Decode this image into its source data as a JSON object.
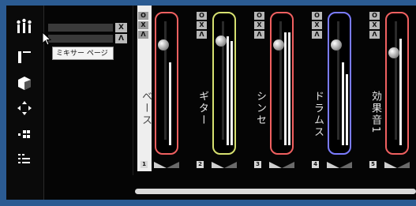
{
  "toolbar": {
    "items": [
      {
        "icon": "mixer-icon",
        "active": true
      },
      {
        "icon": "inspector-panel-icon"
      },
      {
        "icon": "cube-icon"
      },
      {
        "icon": "move-arrows-icon"
      },
      {
        "icon": "grid-dots-icon"
      },
      {
        "icon": "list-icon"
      }
    ]
  },
  "mini_header": {
    "rows": [
      {
        "label": "",
        "button": "X"
      },
      {
        "label": "",
        "button": "Λ"
      }
    ]
  },
  "tooltip": {
    "text": "ミキサー ページ"
  },
  "strip_buttons": {
    "top": "O",
    "mid": "X",
    "bottom": "Λ"
  },
  "channels": [
    {
      "name": "ベース",
      "number": "1",
      "color": "#f06060",
      "highlighted": true,
      "levels": [
        0.7,
        0.0
      ],
      "fader": 0.85
    },
    {
      "name": "ギター",
      "number": "2",
      "color": "#d6e070",
      "levels": [
        0.92,
        0.88
      ],
      "fader": 0.88
    },
    {
      "name": "シンセ",
      "number": "3",
      "color": "#f06060",
      "levels": [
        0.95,
        0.95
      ],
      "fader": 0.85
    },
    {
      "name": "ドラムス",
      "number": "4",
      "color": "#7b7cff",
      "levels": [
        0.7,
        0.6
      ],
      "fader": 0.85
    },
    {
      "name": "効果音1",
      "number": "5",
      "color": "#f06060",
      "levels": [
        0.9,
        0.0
      ],
      "fader": 0.78
    }
  ],
  "colors": {
    "frame": "#2b5b92",
    "background": "#050505"
  }
}
